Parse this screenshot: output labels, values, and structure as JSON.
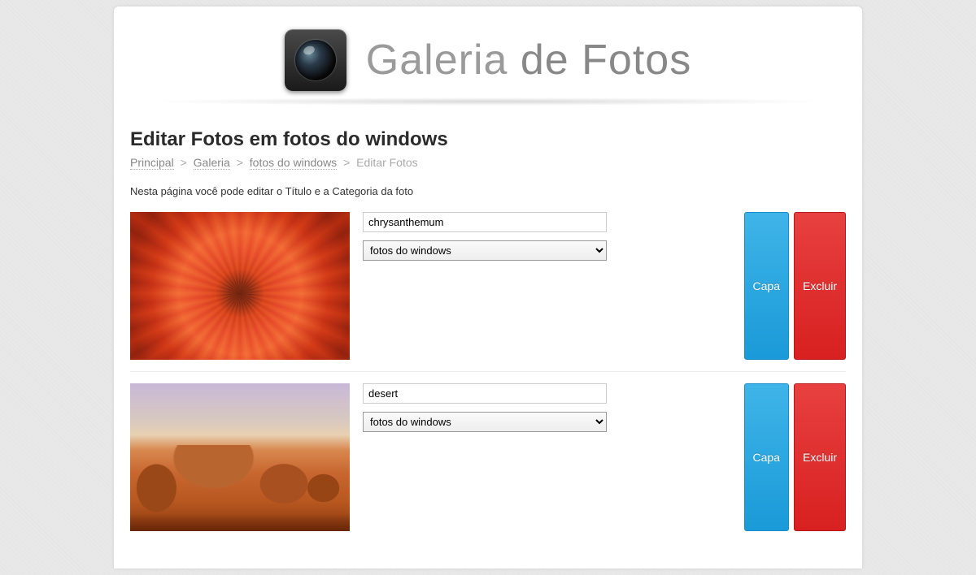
{
  "header": {
    "title_part1": "Galeria",
    "title_part2": "de Fotos"
  },
  "page": {
    "title": "Editar Fotos em fotos do windows",
    "description": "Nesta página você pode editar o Título e a Categoria da foto"
  },
  "breadcrumb": {
    "items": [
      {
        "label": "Principal",
        "link": true
      },
      {
        "label": "Galeria",
        "link": true
      },
      {
        "label": "fotos do windows",
        "link": true
      },
      {
        "label": "Editar Fotos",
        "link": false
      }
    ],
    "separator": ">"
  },
  "buttons": {
    "capa": "Capa",
    "excluir": "Excluir"
  },
  "select_options": [
    "fotos do windows"
  ],
  "photos": [
    {
      "title": "chrysanthemum",
      "category": "fotos do windows",
      "thumb_class": "thumb-flower"
    },
    {
      "title": "desert",
      "category": "fotos do windows",
      "thumb_class": "thumb-desert"
    }
  ]
}
